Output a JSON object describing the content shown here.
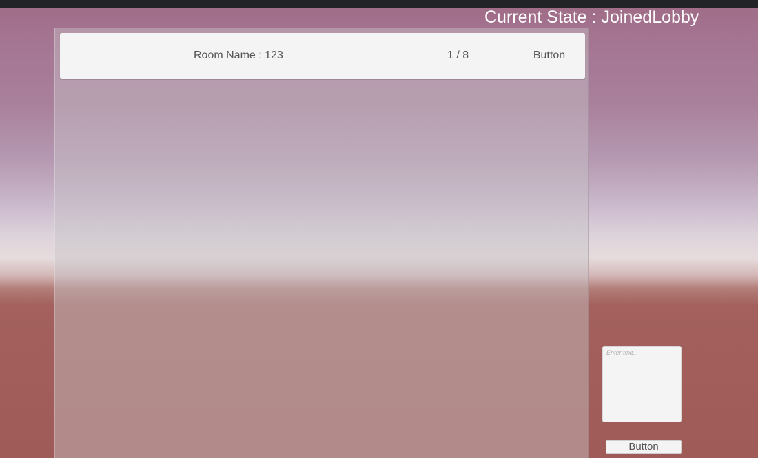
{
  "header": {
    "current_state": "Current State : JoinedLobby"
  },
  "room_list": {
    "rooms": [
      {
        "name": "Room Name : 123",
        "players": "1 / 8",
        "button_label": "Button"
      }
    ]
  },
  "chat": {
    "input_placeholder": "Enter text...",
    "input_value": "",
    "button_label": "Button"
  },
  "colors": {
    "top_bar": "#222326",
    "panel_row": "#f4f4f4",
    "text": "#555555",
    "state_text": "#ffffff"
  }
}
